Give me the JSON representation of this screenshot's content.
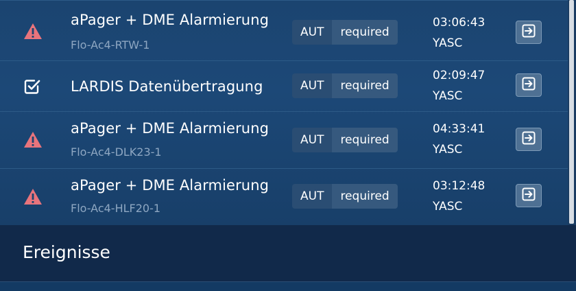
{
  "tasks": [
    {
      "status_icon": "warning-triangle-icon",
      "title": "aPager + DME Alarmierung",
      "subtitle": "Flo-Ac4-RTW-1",
      "badge_left": "AUT",
      "badge_right": "required",
      "time": "03:06:43",
      "assignee": "YASC",
      "action_icon": "arrow-right-box-icon"
    },
    {
      "status_icon": "checkbox-checked-icon",
      "title": "LARDIS Datenübertragung",
      "subtitle": "",
      "badge_left": "AUT",
      "badge_right": "required",
      "time": "02:09:47",
      "assignee": "YASC",
      "action_icon": "arrow-right-box-icon"
    },
    {
      "status_icon": "warning-triangle-icon",
      "title": "aPager + DME Alarmierung",
      "subtitle": "Flo-Ac4-DLK23-1",
      "badge_left": "AUT",
      "badge_right": "required",
      "time": "04:33:41",
      "assignee": "YASC",
      "action_icon": "arrow-right-box-icon"
    },
    {
      "status_icon": "warning-triangle-icon",
      "title": "aPager + DME Alarmierung",
      "subtitle": "Flo-Ac4-HLF20-1",
      "badge_left": "AUT",
      "badge_right": "required",
      "time": "03:12:48",
      "assignee": "YASC",
      "action_icon": "arrow-right-box-icon"
    }
  ],
  "events_section": {
    "title": "Ereignisse"
  },
  "colors": {
    "warning": "#e8747c",
    "check": "#ffffff",
    "badge_left": "#2a4d73",
    "badge_right": "#36597e",
    "button": "#4e7093"
  }
}
